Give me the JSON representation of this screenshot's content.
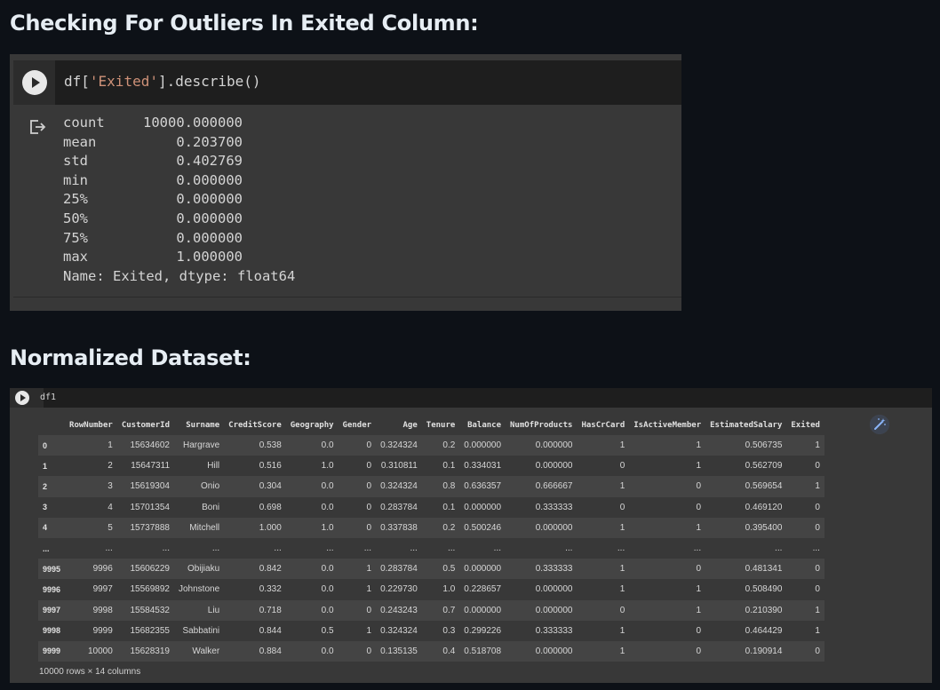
{
  "section1": {
    "heading": "Checking For Outliers In Exited Column:"
  },
  "cell1": {
    "code_prefix": "df[",
    "code_string": "'Exited'",
    "code_suffix": "].describe()",
    "output": [
      {
        "label": "count",
        "value": "10000.000000"
      },
      {
        "label": "mean",
        "value": "0.203700"
      },
      {
        "label": "std",
        "value": "0.402769"
      },
      {
        "label": "min",
        "value": "0.000000"
      },
      {
        "label": "25%",
        "value": "0.000000"
      },
      {
        "label": "50%",
        "value": "0.000000"
      },
      {
        "label": "75%",
        "value": "0.000000"
      },
      {
        "label": "max",
        "value": "1.000000"
      }
    ],
    "output_footer": "Name: Exited, dtype: float64"
  },
  "section2": {
    "heading": "Normalized Dataset:"
  },
  "cell2": {
    "code": "df1",
    "columns": [
      "",
      "RowNumber",
      "CustomerId",
      "Surname",
      "CreditScore",
      "Geography",
      "Gender",
      "Age",
      "Tenure",
      "Balance",
      "NumOfProducts",
      "HasCrCard",
      "IsActiveMember",
      "EstimatedSalary",
      "Exited"
    ],
    "rows": [
      [
        "0",
        "1",
        "15634602",
        "Hargrave",
        "0.538",
        "0.0",
        "0",
        "0.324324",
        "0.2",
        "0.000000",
        "0.000000",
        "1",
        "1",
        "0.506735",
        "1"
      ],
      [
        "1",
        "2",
        "15647311",
        "Hill",
        "0.516",
        "1.0",
        "0",
        "0.310811",
        "0.1",
        "0.334031",
        "0.000000",
        "0",
        "1",
        "0.562709",
        "0"
      ],
      [
        "2",
        "3",
        "15619304",
        "Onio",
        "0.304",
        "0.0",
        "0",
        "0.324324",
        "0.8",
        "0.636357",
        "0.666667",
        "1",
        "0",
        "0.569654",
        "1"
      ],
      [
        "3",
        "4",
        "15701354",
        "Boni",
        "0.698",
        "0.0",
        "0",
        "0.283784",
        "0.1",
        "0.000000",
        "0.333333",
        "0",
        "0",
        "0.469120",
        "0"
      ],
      [
        "4",
        "5",
        "15737888",
        "Mitchell",
        "1.000",
        "1.0",
        "0",
        "0.337838",
        "0.2",
        "0.500246",
        "0.000000",
        "1",
        "1",
        "0.395400",
        "0"
      ],
      [
        "...",
        "...",
        "...",
        "...",
        "...",
        "...",
        "...",
        "...",
        "...",
        "...",
        "...",
        "...",
        "...",
        "...",
        "..."
      ],
      [
        "9995",
        "9996",
        "15606229",
        "Obijiaku",
        "0.842",
        "0.0",
        "1",
        "0.283784",
        "0.5",
        "0.000000",
        "0.333333",
        "1",
        "0",
        "0.481341",
        "0"
      ],
      [
        "9996",
        "9997",
        "15569892",
        "Johnstone",
        "0.332",
        "0.0",
        "1",
        "0.229730",
        "1.0",
        "0.228657",
        "0.000000",
        "1",
        "1",
        "0.508490",
        "0"
      ],
      [
        "9997",
        "9998",
        "15584532",
        "Liu",
        "0.718",
        "0.0",
        "0",
        "0.243243",
        "0.7",
        "0.000000",
        "0.000000",
        "0",
        "1",
        "0.210390",
        "1"
      ],
      [
        "9998",
        "9999",
        "15682355",
        "Sabbatini",
        "0.844",
        "0.5",
        "1",
        "0.324324",
        "0.3",
        "0.299226",
        "0.333333",
        "1",
        "0",
        "0.464429",
        "1"
      ],
      [
        "9999",
        "10000",
        "15628319",
        "Walker",
        "0.884",
        "0.0",
        "0",
        "0.135135",
        "0.4",
        "0.518708",
        "0.000000",
        "1",
        "0",
        "0.190914",
        "0"
      ]
    ],
    "footer": "10000 rows × 14 columns"
  },
  "icons": {
    "run": "play-icon",
    "output": "output-redirect-icon",
    "suggest": "magic-wand-icon"
  }
}
